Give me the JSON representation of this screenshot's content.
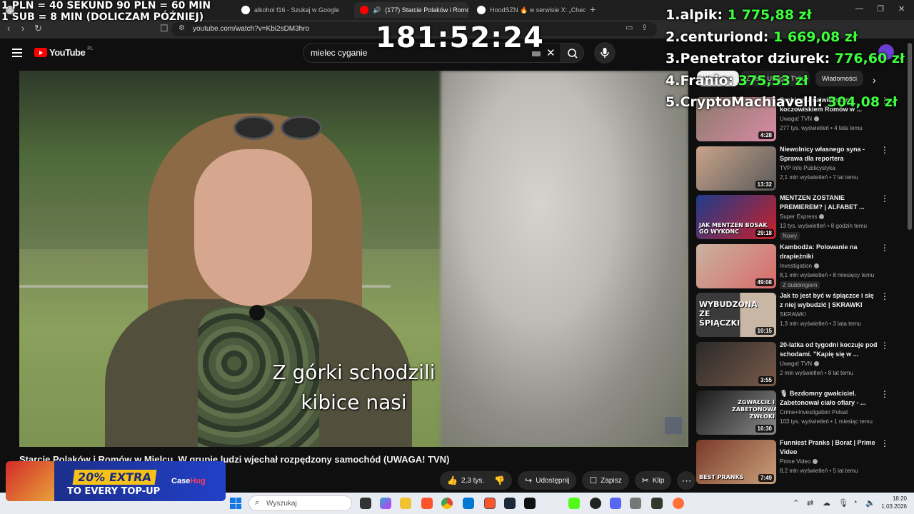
{
  "browser": {
    "tabs": [
      {
        "label": "",
        "favicon_color": "#d0d0d0"
      },
      {
        "label": "alkohol f16 - Szukaj w Google",
        "favicon_color": "#ffffff"
      },
      {
        "label": "(177) Starcie Polaków i Romó",
        "favicon_color": "#ff0000",
        "active": true
      },
      {
        "label": "HoodSZN 🔥 w serwisie X: „Checkin",
        "favicon_color": "#ffffff"
      }
    ],
    "url": "youtube.com/watch?v=Kbi2sDM3hro"
  },
  "overlay": {
    "rule_line1": "1 PLN = 40 SEKUND 90 PLN = 60 MIN",
    "rule_line2": "1 SUB = 8 MIN (DOLICZAM PÓŹNIEJ)",
    "timer": "181:52:24",
    "leaderboard": [
      {
        "rank": "1.",
        "name": "alpik:",
        "amount": "1 775,88 zł"
      },
      {
        "rank": "2.",
        "name": "centuriond:",
        "amount": "1 669,08 zł"
      },
      {
        "rank": "3.",
        "name": "Penetrator dziurek:",
        "amount": "776,60 zł"
      },
      {
        "rank": "4.",
        "name": "Franio:",
        "amount": "375,53 zł"
      },
      {
        "rank": "5.",
        "name": "CryptoMachiavelli:",
        "amount": "304,08 zł"
      }
    ]
  },
  "youtube": {
    "logo_text": "YouTube",
    "country_code": "PL",
    "search_value": "mielec cyganie",
    "subtitle_line1": "Z górki schodzili",
    "subtitle_line2": "kibice nasi",
    "video_title": "Starcie Polaków i Romów w Mielcu. W grupie ludzi wjechał rozpędzony samochód (UWAGA! TVN)",
    "actions": {
      "likes": "2,3 tys.",
      "share": "Udostępnij",
      "save": "Zapisz",
      "clip": "Klip"
    },
    "chips": [
      "Wszystkie",
      "Z serii: Uwaga! TVN",
      "Wiadomości"
    ],
    "recommendations": [
      {
        "title": "Problem z największym koczowiskiem Romów w ...",
        "channel": "Uwaga! TVN",
        "verified": true,
        "meta": "277 tys. wyświetleń • 4 lata temu",
        "duration": "4:28",
        "badge": "",
        "thumb_colors": [
          "#8a7a6a",
          "#d98aa5"
        ],
        "thumb_text": ""
      },
      {
        "title": "Niewolnicy własnego syna - Sprawa dla reportera",
        "channel": "TVP Info Publicystyka",
        "verified": false,
        "meta": "2,1 mln wyświetleń • 7 lat temu",
        "duration": "13:32",
        "badge": "",
        "thumb_colors": [
          "#c9a38a",
          "#5a5a5a"
        ],
        "thumb_text": ""
      },
      {
        "title": "MENTZEN ZOSTANIE PREMIEREM? | ALFABET ...",
        "channel": "Super Express",
        "verified": true,
        "meta": "13 tys. wyświetleń • 8 godzin temu",
        "duration": "29:18",
        "badge": "Nowy",
        "thumb_colors": [
          "#1d3c8c",
          "#c8202a"
        ],
        "thumb_text": "JAK MENTZEN BOSAK GO WYKONC"
      },
      {
        "title": "Kambodża: Polowanie na drapieżniki",
        "channel": "Investigation",
        "verified": true,
        "meta": "8,1 mln wyświetleń • 8 miesięcy temu",
        "duration": "49:08",
        "badge": "Z dubbingiem",
        "thumb_colors": [
          "#c9b3a0",
          "#d86a6a"
        ],
        "thumb_text": ""
      },
      {
        "title": "Jak to jest być w śpiączce i się z niej wybudzić | SKRAWKI",
        "channel": "SKRAWKI",
        "verified": false,
        "meta": "1,3 mln wyświetleń • 3 lata temu",
        "duration": "10:15",
        "badge": "",
        "thumb_colors": [
          "#3a3a3a",
          "#c9b7a5"
        ],
        "thumb_text": "WYBUDZONA ZE ŚPIĄCZKI"
      },
      {
        "title": "20-latka od tygodni koczuje pod schodami. \"Kapię się w ...",
        "channel": "Uwaga! TVN",
        "verified": true,
        "meta": "2 mln wyświetleń • 8 lat temu",
        "duration": "3:55",
        "badge": "",
        "thumb_colors": [
          "#2a2a2a",
          "#7a5a4a"
        ],
        "thumb_text": ""
      },
      {
        "title": "🎙 Bezdomny gwałciciel. Zabetonował ciało ofiary - ...",
        "channel": "Crime+Investigation Polsat",
        "verified": false,
        "meta": "103 tys. wyświetleń • 1 miesiąc temu",
        "duration": "16:30",
        "badge": "",
        "thumb_colors": [
          "#1a1a1a",
          "#8a8a8a"
        ],
        "thumb_text": "ZGWAŁCIŁ I ZABETONOWAŁ ZWŁOKI"
      },
      {
        "title": "Funniest Pranks | Borat | Prime Video",
        "channel": "Prime Video",
        "verified": true,
        "meta": "8,2 mln wyświetleń • 5 lat temu",
        "duration": "7:49",
        "badge": "",
        "thumb_colors": [
          "#7a3a2a",
          "#c9a07a"
        ],
        "thumb_text": "BEST PRANKS"
      }
    ]
  },
  "promo": {
    "line1": "20% EXTRA",
    "line2": "TO EVERY TOP-UP",
    "brand_a": "Case",
    "brand_b": "Hug"
  },
  "taskbar": {
    "search_placeholder": "Wyszukaj",
    "time": "18:20",
    "date": "1.03.2026"
  }
}
